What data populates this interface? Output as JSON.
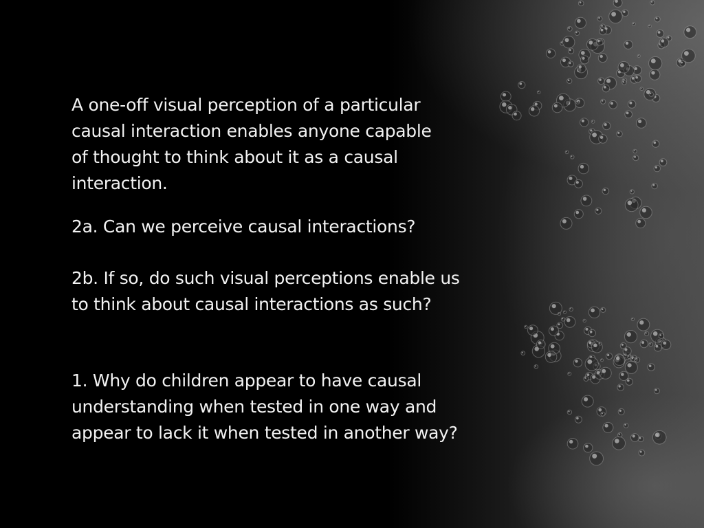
{
  "slide": {
    "intro": "A one-off visual perception of a particular\ncausal interaction enables anyone capable\nof thought to think about it as a causal\ninteraction.",
    "question_2a": "2a. Can we perceive causal interactions?",
    "question_2b": "2b. If so, do such visual perceptions enable us\nto think about causal interactions as such?",
    "question_1": "1. Why do children appear to have causal\nunderstanding when tested in one way and\nappear to lack it when tested in another way?"
  },
  "colors": {
    "background": "#000000",
    "text": "#f2f2f2",
    "texture": "#4a4a4a"
  }
}
